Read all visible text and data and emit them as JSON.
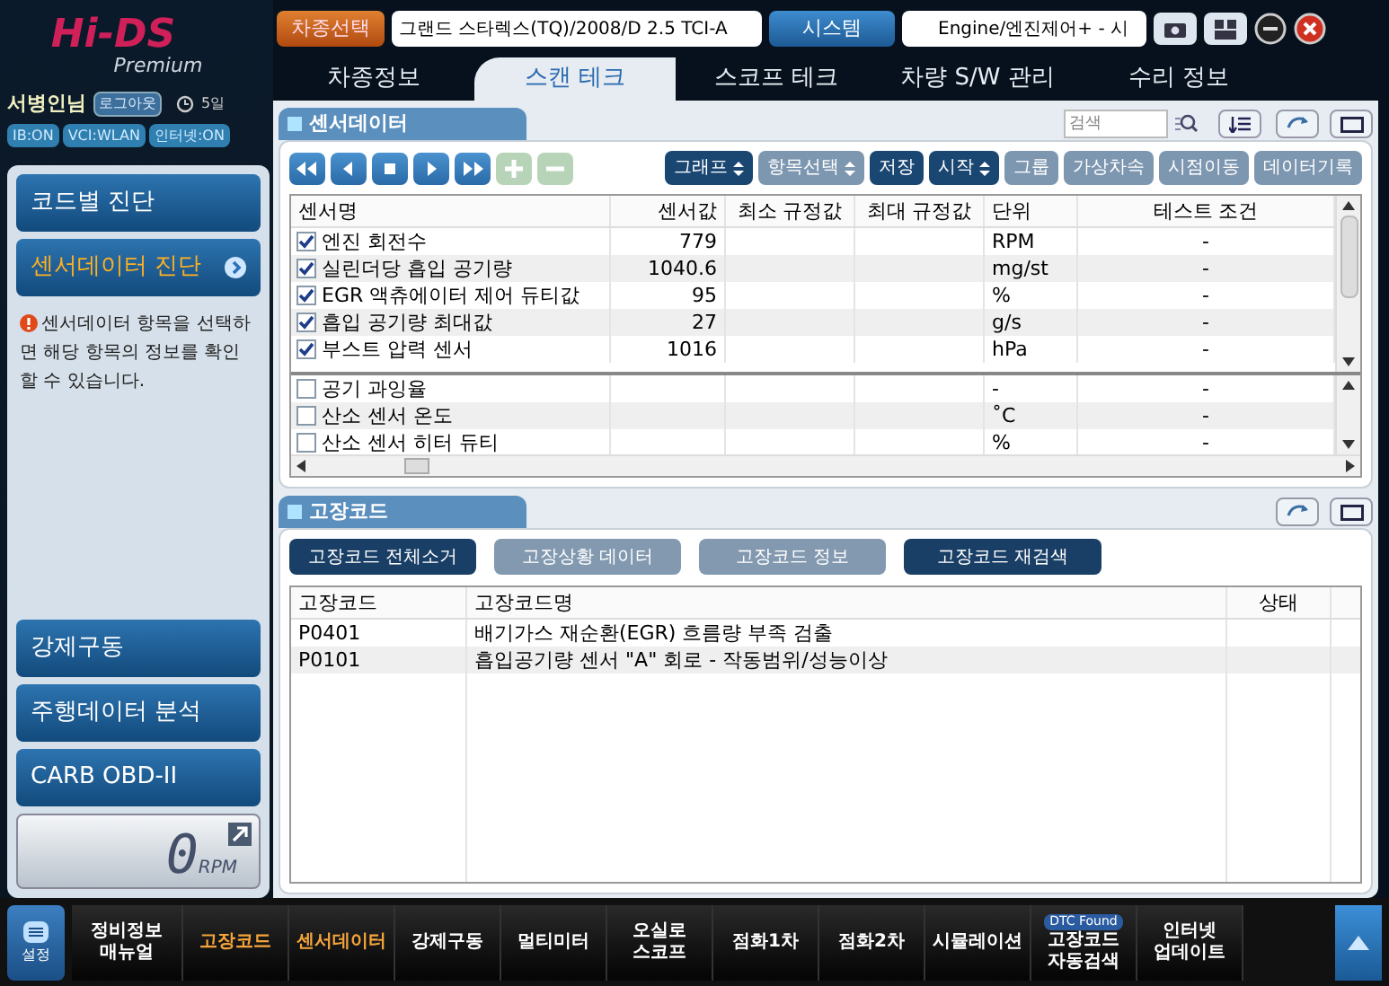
{
  "logo": {
    "brand": "Hi-DS",
    "edition": "Premium"
  },
  "user": {
    "name": "서병인님",
    "logout": "로그아웃",
    "days": "5일"
  },
  "status_chips": [
    {
      "label": "IB:ON"
    },
    {
      "label": "VCI:WLAN"
    },
    {
      "label": "인터넷:ON"
    }
  ],
  "header": {
    "vehicle_button": "차종선택",
    "vehicle": "그랜드 스타렉스(TQ)/2008/D 2.5 TCI-A",
    "system_button": "시스템",
    "system": "Engine/엔진제어+ - 시"
  },
  "tabs": [
    {
      "label": "차종정보",
      "selected": false
    },
    {
      "label": "스캔 테크",
      "selected": true
    },
    {
      "label": "스코프 테크",
      "selected": false
    },
    {
      "label": "차량 S/W 관리",
      "selected": false
    },
    {
      "label": "수리 정보",
      "selected": false
    }
  ],
  "sidebar": {
    "items": [
      {
        "label": "코드별 진단",
        "selected": false
      },
      {
        "label": "센서데이터 진단",
        "selected": true
      }
    ],
    "note": "센서데이터 항목을 선택하면 해당 항목의 정보를 확인 할 수 있습니다.",
    "lower_items": [
      {
        "label": "강제구동"
      },
      {
        "label": "주행데이터 분석"
      },
      {
        "label": "CARB OBD-II"
      }
    ],
    "rpm": {
      "value": "0",
      "unit": "RPM"
    }
  },
  "sensor_panel": {
    "title": "센서데이터",
    "search": {
      "placeholder": "검색"
    },
    "media_buttons": [
      {
        "kind": "rewind",
        "disabled": false
      },
      {
        "kind": "prev",
        "disabled": false
      },
      {
        "kind": "stop",
        "disabled": false
      },
      {
        "kind": "play",
        "disabled": false
      },
      {
        "kind": "forward",
        "disabled": false
      },
      {
        "kind": "plus",
        "disabled": true
      },
      {
        "kind": "minus",
        "disabled": true
      }
    ],
    "toolbar": [
      {
        "label": "그래프",
        "dropdown": true,
        "disabled": false
      },
      {
        "label": "항목선택",
        "dropdown": true,
        "disabled": true
      },
      {
        "label": "저장",
        "dropdown": false,
        "disabled": false
      },
      {
        "label": "시작",
        "dropdown": true,
        "disabled": false
      },
      {
        "label": "그룹",
        "dropdown": false,
        "disabled": true
      },
      {
        "label": "가상차속",
        "dropdown": false,
        "disabled": true
      },
      {
        "label": "시점이동",
        "dropdown": false,
        "disabled": true
      },
      {
        "label": "데이터기록",
        "dropdown": false,
        "disabled": true
      }
    ],
    "columns": [
      "센서명",
      "센서값",
      "최소 규정값",
      "최대 규정값",
      "단위",
      "테스트 조건"
    ],
    "rows": [
      {
        "name": "엔진 회전수",
        "value": "779",
        "unit": "RPM",
        "condition": "-",
        "checked": true
      },
      {
        "name": "실린더당 흡입 공기량",
        "value": "1040.6",
        "unit": "mg/st",
        "condition": "-",
        "checked": true
      },
      {
        "name": "EGR 액츄에이터 제어 듀티값",
        "value": "95",
        "unit": "%",
        "condition": "-",
        "checked": true
      },
      {
        "name": "흡입 공기량 최대값",
        "value": "27",
        "unit": "g/s",
        "condition": "-",
        "checked": true
      },
      {
        "name": "부스트 압력 센서",
        "value": "1016",
        "unit": "hPa",
        "condition": "-",
        "checked": true
      }
    ],
    "other_rows": [
      {
        "name": "공기 과잉율",
        "value": "",
        "unit": "-",
        "condition": "-",
        "checked": false
      },
      {
        "name": "산소 센서 온도",
        "value": "",
        "unit": "˚C",
        "condition": "-",
        "checked": false
      },
      {
        "name": "산소 센서 히터 듀티",
        "value": "",
        "unit": "%",
        "condition": "-",
        "checked": false
      }
    ]
  },
  "fault_panel": {
    "title": "고장코드",
    "buttons": [
      {
        "label": "고장코드 전체소거",
        "disabled": false
      },
      {
        "label": "고장상황 데이터",
        "disabled": true
      },
      {
        "label": "고장코드 정보",
        "disabled": true
      },
      {
        "label": "고장코드 재검색",
        "disabled": false
      }
    ],
    "columns": [
      "고장코드",
      "고장코드명",
      "상태"
    ],
    "rows": [
      {
        "code": "P0401",
        "name": "배기가스 재순환(EGR) 흐름량 부족 검출"
      },
      {
        "code": "P0101",
        "name": "흡입공기량 센서 \"A\" 회로 - 작동범위/성능이상"
      }
    ]
  },
  "bottom_bar": {
    "settings": "설정",
    "items": [
      {
        "label": "정비정보 매뉴얼",
        "highlighted": false
      },
      {
        "label": "고장코드",
        "highlighted": true
      },
      {
        "label": "센서데이터",
        "highlighted": true
      },
      {
        "label": "강제구동",
        "highlighted": false
      },
      {
        "label": "멀티미터",
        "highlighted": false
      },
      {
        "label": "오실로 스코프",
        "highlighted": false
      },
      {
        "label": "점화1차",
        "highlighted": false
      },
      {
        "label": "점화2차",
        "highlighted": false
      },
      {
        "label": "시뮬레이션",
        "highlighted": false
      },
      {
        "label": "고장코드 자동검색",
        "highlighted": false,
        "badge": "DTC Found"
      },
      {
        "label": "인터넷 업데이트",
        "highlighted": false
      }
    ]
  }
}
